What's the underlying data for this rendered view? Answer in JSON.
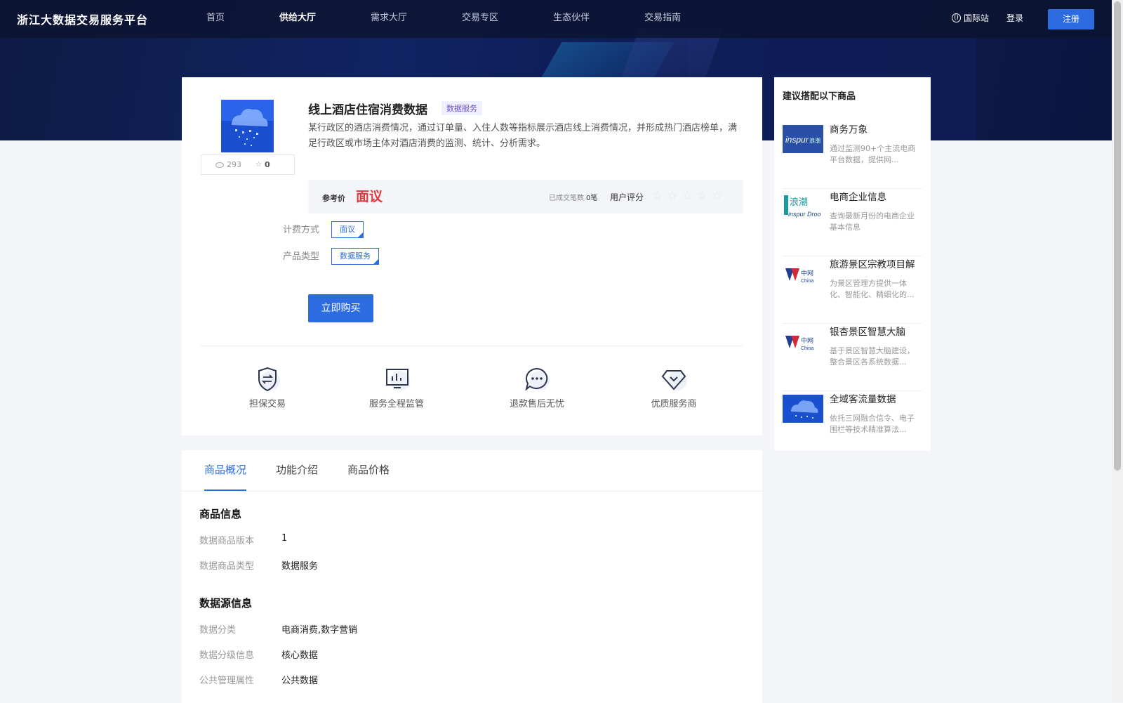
{
  "header": {
    "logo": "浙江大数据交易服务平台",
    "nav": [
      "首页",
      "供给大厅",
      "需求大厅",
      "交易专区",
      "生态伙伴",
      "交易指南"
    ],
    "intl": "国际站",
    "login": "登录",
    "register": "注册"
  },
  "product": {
    "title": "线上酒店住宿消费数据",
    "badge": "数据服务",
    "description": "某行政区的酒店消费情况，通过订单量、入住人数等指标展示酒店线上消费情况，并形成热门酒店榜单，满足行政区或市场主体对酒店消费的监测、统计、分析需求。",
    "views": "293",
    "favorites": "0",
    "price_label": "参考价",
    "price_value": "面议",
    "deals_label": "已成交笔数",
    "deals_value": "0笔",
    "rating_label": "用户评分",
    "rating_stars": [
      "☆",
      "☆",
      "☆",
      "☆",
      "☆"
    ],
    "billing_label": "计费方式",
    "billing_option": "面议",
    "type_label": "产品类型",
    "type_option": "数据服务",
    "buy_button": "立即购买",
    "features": [
      "担保交易",
      "服务全程监管",
      "退款售后无忧",
      "优质服务商"
    ]
  },
  "sidebar": {
    "title": "建议搭配以下商品",
    "items": [
      {
        "name": "商务万象",
        "desc": "通过监测90+个主流电商平台数据，提供网..."
      },
      {
        "name": "电商企业信息",
        "desc": "查询最新月份的电商企业基本信息"
      },
      {
        "name": "旅游景区宗教项目解",
        "desc": "为景区管理方提供一体化、智能化、精细化的..."
      },
      {
        "name": "银杏景区智慧大脑",
        "desc": "基于景区智慧大脑建设，整合景区各系统数据..."
      },
      {
        "name": "全域客流量数据",
        "desc": "依托三网融合信令、电子围栏等技术精准算法..."
      }
    ]
  },
  "tabs": [
    "商品概况",
    "功能介绍",
    "商品价格"
  ],
  "details": {
    "section1": "商品信息",
    "version_label": "数据商品版本",
    "version_value": "1",
    "dtype_label": "数据商品类型",
    "dtype_value": "数据服务",
    "section2": "数据源信息",
    "category_label": "数据分类",
    "category_value": "电商消费,数字营销",
    "grade_label": "数据分级信息",
    "grade_value": "核心数据",
    "attr_label": "公共管理属性",
    "attr_value": "公共数据"
  }
}
